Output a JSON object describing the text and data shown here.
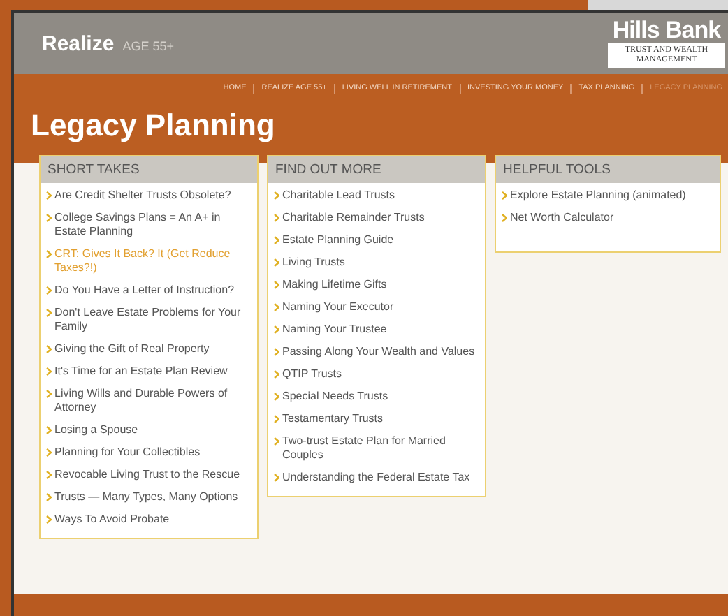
{
  "header": {
    "brand": "Realize",
    "brand_suffix": "AGE 55+",
    "logo_title": "Hills Bank",
    "logo_subtitle": "TRUST AND WEALTH MANAGEMENT"
  },
  "nav": [
    {
      "label": "HOME",
      "selected": false
    },
    {
      "label": "REALIZE AGE 55+",
      "selected": false
    },
    {
      "label": "LIVING WELL IN RETIREMENT",
      "selected": false
    },
    {
      "label": "INVESTING YOUR MONEY",
      "selected": false
    },
    {
      "label": "TAX PLANNING",
      "selected": false
    },
    {
      "label": "LEGACY PLANNING",
      "selected": true
    }
  ],
  "page_title": "Legacy Planning",
  "panels": [
    {
      "title": "SHORT TAKES",
      "items": [
        {
          "text": "Are Credit Shelter Trusts Obsolete?",
          "highlighted": false
        },
        {
          "text": "College Savings Plans = An A+ in Estate Planning",
          "highlighted": false
        },
        {
          "text": "CRT: Gives It Back? It (Get Reduce Taxes?!)",
          "highlighted": true
        },
        {
          "text": "Do You Have a Letter of Instruction?",
          "highlighted": false
        },
        {
          "text": "Don't Leave Estate Problems for Your Family",
          "highlighted": false
        },
        {
          "text": "Giving the Gift of Real Property",
          "highlighted": false
        },
        {
          "text": "It's Time for an Estate Plan Review",
          "highlighted": false
        },
        {
          "text": "Living Wills and Durable Powers of Attorney",
          "highlighted": false
        },
        {
          "text": "Losing a Spouse",
          "highlighted": false
        },
        {
          "text": "Planning for Your Collectibles",
          "highlighted": false
        },
        {
          "text": "Revocable Living Trust to the Rescue",
          "highlighted": false
        },
        {
          "text": "Trusts — Many Types, Many Options",
          "highlighted": false
        },
        {
          "text": "Ways To Avoid Probate",
          "highlighted": false
        }
      ]
    },
    {
      "title": "FIND OUT MORE",
      "items": [
        {
          "text": "Charitable Lead Trusts",
          "highlighted": false
        },
        {
          "text": "Charitable Remainder Trusts",
          "highlighted": false
        },
        {
          "text": "Estate Planning Guide",
          "highlighted": false
        },
        {
          "text": "Living Trusts",
          "highlighted": false
        },
        {
          "text": "Making Lifetime Gifts",
          "highlighted": false
        },
        {
          "text": "Naming Your Executor",
          "highlighted": false
        },
        {
          "text": "Naming Your Trustee",
          "highlighted": false
        },
        {
          "text": "Passing Along Your Wealth and Values",
          "highlighted": false
        },
        {
          "text": "QTIP Trusts",
          "highlighted": false
        },
        {
          "text": "Special Needs Trusts",
          "highlighted": false
        },
        {
          "text": "Testamentary Trusts",
          "highlighted": false
        },
        {
          "text": "Two-trust Estate Plan for Married Couples",
          "highlighted": false
        },
        {
          "text": "Understanding the Federal Estate Tax",
          "highlighted": false
        }
      ]
    },
    {
      "title": "HELPFUL TOOLS",
      "items": [
        {
          "text": "Explore Estate Planning (animated)",
          "highlighted": false
        },
        {
          "text": "Net Worth Calculator",
          "highlighted": false
        }
      ]
    }
  ]
}
